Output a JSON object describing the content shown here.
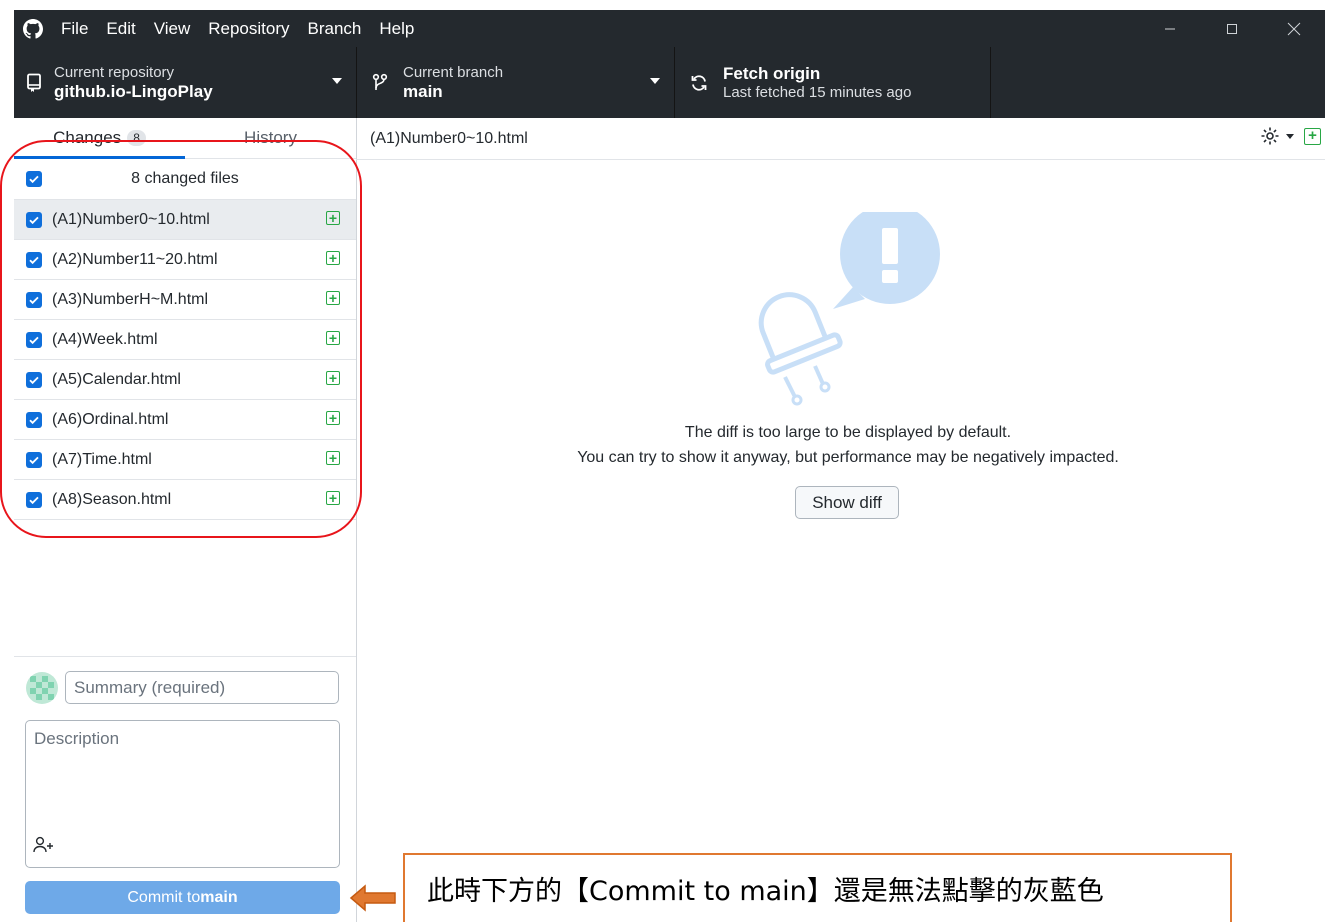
{
  "menu": {
    "items": [
      "File",
      "Edit",
      "View",
      "Repository",
      "Branch",
      "Help"
    ]
  },
  "toolbar": {
    "repo_label": "Current repository",
    "repo_name": "github.io-LingoPlay",
    "branch_label": "Current branch",
    "branch_name": "main",
    "fetch_title": "Fetch origin",
    "fetch_sub": "Last fetched 15 minutes ago"
  },
  "sidebar": {
    "tabs": [
      {
        "label": "Changes",
        "count": "8"
      },
      {
        "label": "History"
      }
    ],
    "changed_files_label": "8 changed files",
    "files": [
      "(A1)Number0~10.html",
      "(A2)Number11~20.html",
      "(A3)NumberH~M.html",
      "(A4)Week.html",
      "(A5)Calendar.html",
      "(A6)Ordinal.html",
      "(A7)Time.html",
      "(A8)Season.html"
    ]
  },
  "commit": {
    "summary_placeholder": "Summary (required)",
    "description_placeholder": "Description",
    "button_prefix": "Commit to ",
    "button_branch": "main"
  },
  "diff": {
    "path": "(A1)Number0~10.html",
    "message_line1": "The diff is too large to be displayed by default.",
    "message_line2": "You can try to show it anyway, but performance may be negatively impacted.",
    "show_diff_label": "Show diff"
  },
  "annotation": {
    "callout_text": "此時下方的【Commit to main】還是無法點擊的灰藍色"
  },
  "colors": {
    "toolbar_bg": "#24292e",
    "accent_blue": "#0366d6",
    "added_green": "#28a745",
    "commit_disabled": "#6ea9e8",
    "annotation_red": "#e8151b",
    "callout_orange": "#e07830"
  }
}
